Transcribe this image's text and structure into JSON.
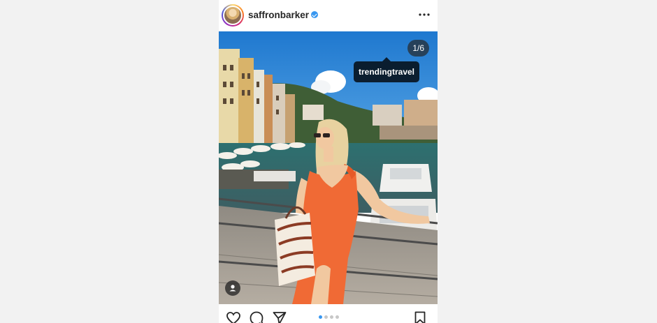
{
  "post": {
    "username": "saffronbarker",
    "image_counter": "1/6",
    "tagged_account": "trendingtravel",
    "carousel": {
      "total": 4,
      "active_index": 0
    }
  },
  "icons": {
    "verified": "verified-badge-icon",
    "more": "more-options-icon",
    "like": "heart-icon",
    "comment": "comment-icon",
    "share": "share-icon",
    "save": "bookmark-icon",
    "tags": "user-tag-icon"
  },
  "colors": {
    "verified_blue": "#3897f0",
    "dress_orange": "#f06a35",
    "sky_blue": "#2d86d6"
  }
}
